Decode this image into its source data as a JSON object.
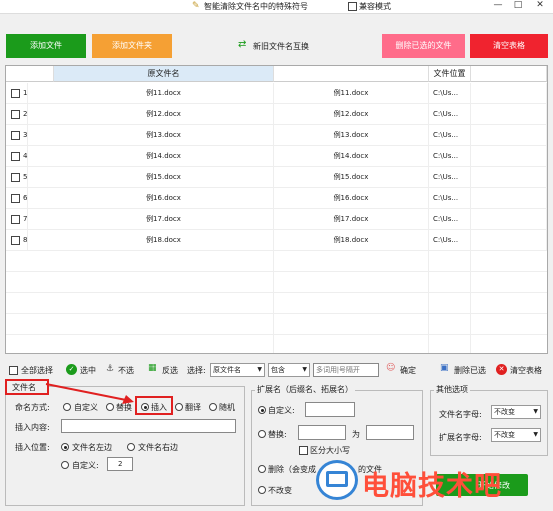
{
  "titlebar": {
    "title": "智能清除文件名中的特殊符号",
    "compat_label": "兼容模式",
    "minimize": "—",
    "maximize": "□",
    "close": "✕"
  },
  "toolbar": {
    "add_file": "添加文件",
    "add_folder": "添加文件夹",
    "swap_names": "新旧文件名互换",
    "delete_selected": "删除已选的文件",
    "clear_table": "清空表格"
  },
  "table": {
    "headers": {
      "original": "原文件名",
      "location": "文件位置"
    },
    "rows": [
      {
        "num": "1",
        "original": "例11.docx",
        "new": "例11.docx",
        "location": "C:\\Us..."
      },
      {
        "num": "2",
        "original": "例12.docx",
        "new": "例12.docx",
        "location": "C:\\Us..."
      },
      {
        "num": "3",
        "original": "例13.docx",
        "new": "例13.docx",
        "location": "C:\\Us..."
      },
      {
        "num": "4",
        "original": "例14.docx",
        "new": "例14.docx",
        "location": "C:\\Us..."
      },
      {
        "num": "5",
        "original": "例15.docx",
        "new": "例15.docx",
        "location": "C:\\Us..."
      },
      {
        "num": "6",
        "original": "例16.docx",
        "new": "例16.docx",
        "location": "C:\\Us..."
      },
      {
        "num": "7",
        "original": "例17.docx",
        "new": "例17.docx",
        "location": "C:\\Us..."
      },
      {
        "num": "8",
        "original": "例18.docx",
        "new": "例18.docx",
        "location": "C:\\Us..."
      }
    ]
  },
  "actionbar": {
    "select_all": "全部选择",
    "select": "选中",
    "deselect": "不选",
    "invert": "反选",
    "choose_label": "选择:",
    "field_select": "原文件名",
    "match_select": "包含",
    "keywords_placeholder": "多词用|号隔开",
    "confirm": "确定",
    "delete_selected": "删除已选",
    "clear_table": "清空表格"
  },
  "filename_panel": {
    "title": "文件名",
    "mode_label": "命名方式:",
    "modes": [
      "自定义",
      "替换",
      "插入",
      "翻译",
      "随机"
    ],
    "selected_mode": "插入",
    "insert_content_label": "插入内容:",
    "insert_content_value": "",
    "position_label": "插入位置:",
    "positions": [
      "文件名左边",
      "文件名右边"
    ],
    "custom_label": "自定义:",
    "custom_value": "2"
  },
  "extension_panel": {
    "title": "扩展名（后缀名、拓展名）",
    "custom_label": "自定义:",
    "replace_label": "替换:",
    "replace_as": "为",
    "case_label": "区分大小写",
    "delete_label": "删除（会变成",
    "delete_tail": "的文件",
    "unchanged_label": "不改变",
    "start_button": "开始修改"
  },
  "other_panel": {
    "title": "其他选项",
    "font_name_label": "文件名字母:",
    "font_name_value": "不改变",
    "ext_letter_label": "扩展名字母:",
    "ext_letter_value": "不改变"
  },
  "watermark": {
    "text": "电脑技术吧"
  },
  "colors": {
    "green": "#1b9b1b",
    "orange": "#f5a034",
    "pink": "#ff6c8a",
    "red": "#f0232f",
    "selected_header": "#dbeaf7",
    "watermark": "#ff4f3a"
  }
}
